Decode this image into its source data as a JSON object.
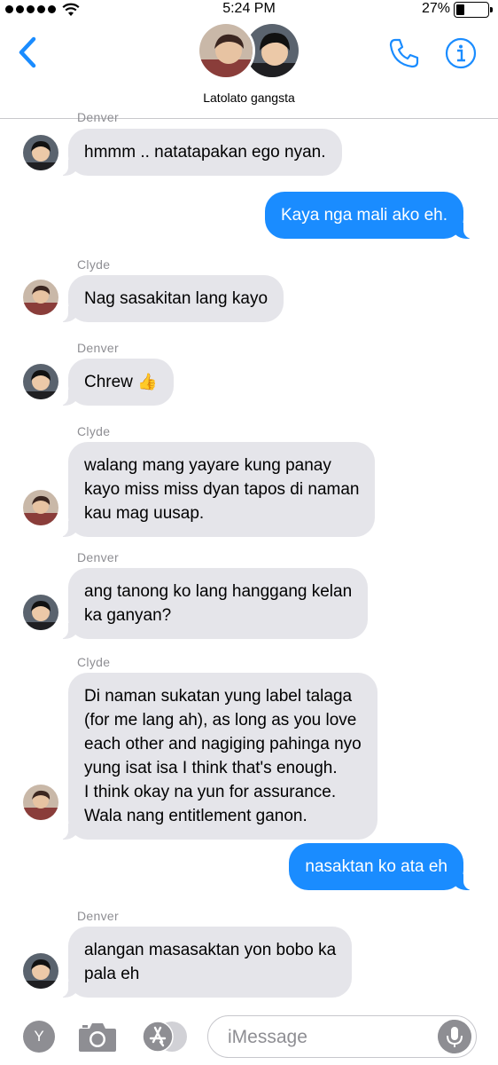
{
  "status_bar": {
    "time": "5:24 PM",
    "battery_percent": "27%",
    "battery_level": 0.27
  },
  "header": {
    "title": "Latolato gangsta"
  },
  "colors": {
    "accent": "#1a8cff",
    "incoming_bubble": "#e5e5ea",
    "secondary_text": "#8e8e93"
  },
  "messages": [
    {
      "sender": "Denver",
      "text": "hmmm .. natatapakan ego nyan."
    },
    {
      "text": "Kaya nga mali ako eh."
    },
    {
      "sender": "Clyde",
      "text": "Nag sasakitan lang kayo"
    },
    {
      "sender": "Denver",
      "text": "Chrew",
      "emoji": "👍"
    },
    {
      "sender": "Clyde",
      "lines": [
        "walang mang yayare kung panay",
        "kayo miss miss dyan tapos di naman",
        "kau mag uusap."
      ]
    },
    {
      "sender": "Denver",
      "lines": [
        "ang tanong ko lang hanggang kelan",
        "ka ganyan?"
      ]
    },
    {
      "sender": "Clyde",
      "lines": [
        "Di naman sukatan yung label talaga",
        "(for me lang ah), as long as you love",
        "each other and nagiging pahinga nyo",
        "yung isat isa I think that's enough.",
        "I think okay na yun for assurance.",
        "Wala nang entitlement ganon."
      ]
    },
    {
      "text": "nasaktan ko ata eh"
    },
    {
      "sender": "Denver",
      "lines": [
        "alangan masasaktan yon bobo ka",
        "pala eh"
      ]
    }
  ],
  "input_bar": {
    "y_button": "Y",
    "placeholder": "iMessage"
  },
  "icons": [
    "back-chevron-icon",
    "phone-icon",
    "info-icon",
    "camera-icon",
    "app-store-icon",
    "microphone-icon",
    "thumbs-up-icon"
  ]
}
